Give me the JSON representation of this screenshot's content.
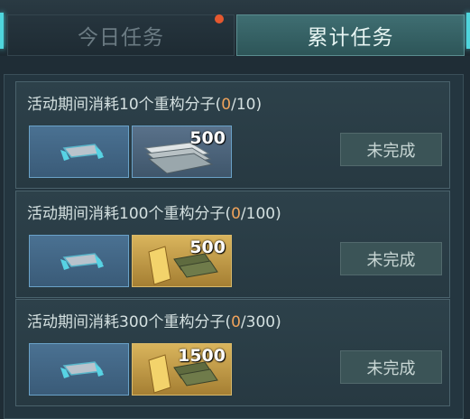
{
  "tabs": {
    "daily": "今日任务",
    "cumulative": "累计任务"
  },
  "tasks": [
    {
      "title": "活动期间消耗10个重构分子(",
      "progress": "0",
      "target": "/10)",
      "reward_qty": "500",
      "reward_type": "silver-icon",
      "status": "未完成"
    },
    {
      "title": "活动期间消耗100个重构分子(",
      "progress": "0",
      "target": "/100)",
      "reward_qty": "500",
      "reward_type": "gold-bar-icon",
      "status": "未完成"
    },
    {
      "title": "活动期间消耗300个重构分子(",
      "progress": "0",
      "target": "/300)",
      "reward_qty": "1500",
      "reward_type": "gold-bar-icon",
      "status": "未完成"
    }
  ],
  "colors": {
    "accent": "#4fd6dd",
    "progress": "#f0a35b",
    "notify_dot": "#e5582f"
  }
}
